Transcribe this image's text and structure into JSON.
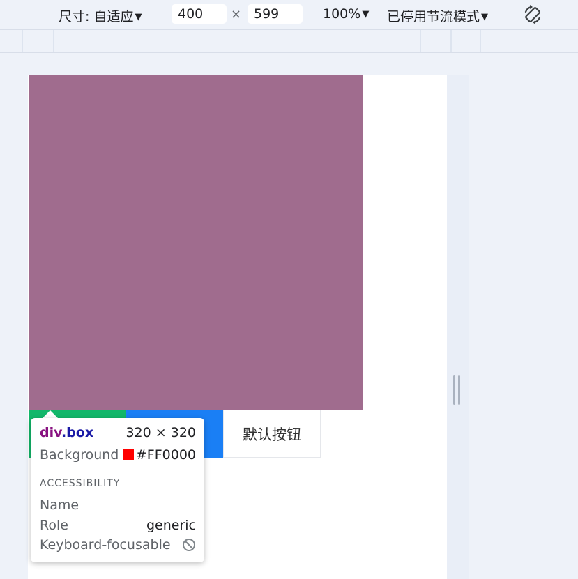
{
  "toolbar": {
    "size_label": "尺寸: 自适应",
    "width_value": "400",
    "times_sign": "×",
    "height_value": "599",
    "zoom_label": "100%",
    "throttle_label": "已停用节流模式",
    "caret": "▼"
  },
  "page": {
    "box_color": "#A06C8E",
    "buttons": [
      {
        "label": "",
        "color": "#12B76A"
      },
      {
        "label": "",
        "color": "#1A7FF5"
      },
      {
        "label": "默认按钮",
        "color": "#FFFFFF"
      }
    ]
  },
  "tooltip": {
    "tag": "div",
    "class_name": ".box",
    "dimensions": "320 × 320",
    "background_label": "Background",
    "background_value": "#FF0000",
    "accessibility_title": "ACCESSIBILITY",
    "name_label": "Name",
    "name_value": "",
    "role_label": "Role",
    "role_value": "generic",
    "focusable_label": "Keyboard-focusable"
  }
}
